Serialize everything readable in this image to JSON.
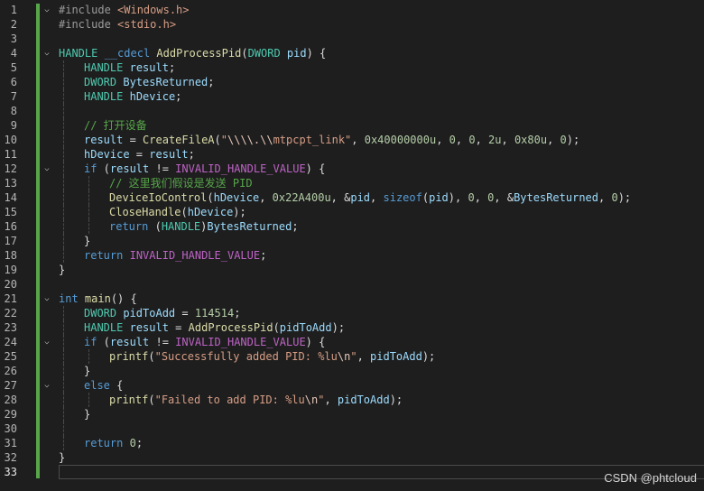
{
  "watermark": "CSDN @phtcloud",
  "current_line": 33,
  "lines": [
    {
      "n": "1",
      "fold": "v",
      "indent": 0,
      "tokens": [
        [
          "t-pp",
          "#include "
        ],
        [
          "t-inc",
          "<Windows.h>"
        ]
      ]
    },
    {
      "n": "2",
      "fold": "",
      "indent": 0,
      "tokens": [
        [
          "t-pp",
          "#include "
        ],
        [
          "t-inc",
          "<stdio.h>"
        ]
      ]
    },
    {
      "n": "3",
      "fold": "",
      "indent": 0,
      "tokens": []
    },
    {
      "n": "4",
      "fold": "v",
      "indent": 0,
      "tokens": [
        [
          "t-type",
          "HANDLE"
        ],
        [
          "t-plain",
          " "
        ],
        [
          "t-kw",
          "__cdecl"
        ],
        [
          "t-plain",
          " "
        ],
        [
          "t-fn",
          "AddProcessPid"
        ],
        [
          "t-plain",
          "("
        ],
        [
          "t-type",
          "DWORD"
        ],
        [
          "t-plain",
          " "
        ],
        [
          "t-var",
          "pid"
        ],
        [
          "t-plain",
          ") {"
        ]
      ]
    },
    {
      "n": "5",
      "fold": "",
      "indent": 1,
      "tokens": [
        [
          "t-type",
          "HANDLE"
        ],
        [
          "t-plain",
          " "
        ],
        [
          "t-var",
          "result"
        ],
        [
          "t-plain",
          ";"
        ]
      ]
    },
    {
      "n": "6",
      "fold": "",
      "indent": 1,
      "tokens": [
        [
          "t-type",
          "DWORD"
        ],
        [
          "t-plain",
          " "
        ],
        [
          "t-var",
          "BytesReturned"
        ],
        [
          "t-plain",
          ";"
        ]
      ]
    },
    {
      "n": "7",
      "fold": "",
      "indent": 1,
      "tokens": [
        [
          "t-type",
          "HANDLE"
        ],
        [
          "t-plain",
          " "
        ],
        [
          "t-var",
          "hDevice"
        ],
        [
          "t-plain",
          ";"
        ]
      ]
    },
    {
      "n": "8",
      "fold": "",
      "indent": 1,
      "tokens": []
    },
    {
      "n": "9",
      "fold": "",
      "indent": 1,
      "tokens": [
        [
          "t-cmt",
          "// 打开设备"
        ]
      ]
    },
    {
      "n": "10",
      "fold": "",
      "indent": 1,
      "tokens": [
        [
          "t-var",
          "result"
        ],
        [
          "t-plain",
          " = "
        ],
        [
          "t-fn",
          "CreateFileA"
        ],
        [
          "t-plain",
          "("
        ],
        [
          "t-str",
          "\""
        ],
        [
          "t-esc",
          "\\\\\\\\.\\\\"
        ],
        [
          "t-str",
          "mtpcpt_link\""
        ],
        [
          "t-plain",
          ", "
        ],
        [
          "t-num",
          "0x40000000u"
        ],
        [
          "t-plain",
          ", "
        ],
        [
          "t-num",
          "0"
        ],
        [
          "t-plain",
          ", "
        ],
        [
          "t-num",
          "0"
        ],
        [
          "t-plain",
          ", "
        ],
        [
          "t-num",
          "2u"
        ],
        [
          "t-plain",
          ", "
        ],
        [
          "t-num",
          "0x80u"
        ],
        [
          "t-plain",
          ", "
        ],
        [
          "t-num",
          "0"
        ],
        [
          "t-plain",
          ");"
        ]
      ]
    },
    {
      "n": "11",
      "fold": "",
      "indent": 1,
      "tokens": [
        [
          "t-var",
          "hDevice"
        ],
        [
          "t-plain",
          " = "
        ],
        [
          "t-var",
          "result"
        ],
        [
          "t-plain",
          ";"
        ]
      ]
    },
    {
      "n": "12",
      "fold": "v",
      "indent": 1,
      "tokens": [
        [
          "t-kw",
          "if"
        ],
        [
          "t-plain",
          " ("
        ],
        [
          "t-var",
          "result"
        ],
        [
          "t-plain",
          " != "
        ],
        [
          "t-macro",
          "INVALID_HANDLE_VALUE"
        ],
        [
          "t-plain",
          ") {"
        ]
      ]
    },
    {
      "n": "13",
      "fold": "",
      "indent": 2,
      "tokens": [
        [
          "t-cmt",
          "// 这里我们假设是发送 PID"
        ]
      ]
    },
    {
      "n": "14",
      "fold": "",
      "indent": 2,
      "tokens": [
        [
          "t-fn",
          "DeviceIoControl"
        ],
        [
          "t-plain",
          "("
        ],
        [
          "t-var",
          "hDevice"
        ],
        [
          "t-plain",
          ", "
        ],
        [
          "t-num",
          "0x22A400u"
        ],
        [
          "t-plain",
          ", &"
        ],
        [
          "t-var",
          "pid"
        ],
        [
          "t-plain",
          ", "
        ],
        [
          "t-kw",
          "sizeof"
        ],
        [
          "t-plain",
          "("
        ],
        [
          "t-var",
          "pid"
        ],
        [
          "t-plain",
          "), "
        ],
        [
          "t-num",
          "0"
        ],
        [
          "t-plain",
          ", "
        ],
        [
          "t-num",
          "0"
        ],
        [
          "t-plain",
          ", &"
        ],
        [
          "t-var",
          "BytesReturned"
        ],
        [
          "t-plain",
          ", "
        ],
        [
          "t-num",
          "0"
        ],
        [
          "t-plain",
          ");"
        ]
      ]
    },
    {
      "n": "15",
      "fold": "",
      "indent": 2,
      "tokens": [
        [
          "t-fn",
          "CloseHandle"
        ],
        [
          "t-plain",
          "("
        ],
        [
          "t-var",
          "hDevice"
        ],
        [
          "t-plain",
          ");"
        ]
      ]
    },
    {
      "n": "16",
      "fold": "",
      "indent": 2,
      "tokens": [
        [
          "t-kw",
          "return"
        ],
        [
          "t-plain",
          " ("
        ],
        [
          "t-type",
          "HANDLE"
        ],
        [
          "t-plain",
          ")"
        ],
        [
          "t-var",
          "BytesReturned"
        ],
        [
          "t-plain",
          ";"
        ]
      ]
    },
    {
      "n": "17",
      "fold": "",
      "indent": 1,
      "tokens": [
        [
          "t-plain",
          "}"
        ]
      ]
    },
    {
      "n": "18",
      "fold": "",
      "indent": 1,
      "tokens": [
        [
          "t-kw",
          "return"
        ],
        [
          "t-plain",
          " "
        ],
        [
          "t-macro",
          "INVALID_HANDLE_VALUE"
        ],
        [
          "t-plain",
          ";"
        ]
      ]
    },
    {
      "n": "19",
      "fold": "",
      "indent": 0,
      "tokens": [
        [
          "t-plain",
          "}"
        ]
      ]
    },
    {
      "n": "20",
      "fold": "",
      "indent": 0,
      "tokens": []
    },
    {
      "n": "21",
      "fold": "v",
      "indent": 0,
      "tokens": [
        [
          "t-kw",
          "int"
        ],
        [
          "t-plain",
          " "
        ],
        [
          "t-fn",
          "main"
        ],
        [
          "t-plain",
          "() {"
        ]
      ]
    },
    {
      "n": "22",
      "fold": "",
      "indent": 1,
      "tokens": [
        [
          "t-type",
          "DWORD"
        ],
        [
          "t-plain",
          " "
        ],
        [
          "t-var",
          "pidToAdd"
        ],
        [
          "t-plain",
          " = "
        ],
        [
          "t-num",
          "114514"
        ],
        [
          "t-plain",
          ";"
        ]
      ]
    },
    {
      "n": "23",
      "fold": "",
      "indent": 1,
      "tokens": [
        [
          "t-type",
          "HANDLE"
        ],
        [
          "t-plain",
          " "
        ],
        [
          "t-var",
          "result"
        ],
        [
          "t-plain",
          " = "
        ],
        [
          "t-fn",
          "AddProcessPid"
        ],
        [
          "t-plain",
          "("
        ],
        [
          "t-var",
          "pidToAdd"
        ],
        [
          "t-plain",
          ");"
        ]
      ]
    },
    {
      "n": "24",
      "fold": "v",
      "indent": 1,
      "tokens": [
        [
          "t-kw",
          "if"
        ],
        [
          "t-plain",
          " ("
        ],
        [
          "t-var",
          "result"
        ],
        [
          "t-plain",
          " != "
        ],
        [
          "t-macro",
          "INVALID_HANDLE_VALUE"
        ],
        [
          "t-plain",
          ") {"
        ]
      ]
    },
    {
      "n": "25",
      "fold": "",
      "indent": 2,
      "tokens": [
        [
          "t-fn",
          "printf"
        ],
        [
          "t-plain",
          "("
        ],
        [
          "t-str",
          "\"Successfully added PID: %lu"
        ],
        [
          "t-esc",
          "\\n"
        ],
        [
          "t-str",
          "\""
        ],
        [
          "t-plain",
          ", "
        ],
        [
          "t-var",
          "pidToAdd"
        ],
        [
          "t-plain",
          ");"
        ]
      ]
    },
    {
      "n": "26",
      "fold": "",
      "indent": 1,
      "tokens": [
        [
          "t-plain",
          "}"
        ]
      ]
    },
    {
      "n": "27",
      "fold": "v",
      "indent": 1,
      "tokens": [
        [
          "t-kw",
          "else"
        ],
        [
          "t-plain",
          " {"
        ]
      ]
    },
    {
      "n": "28",
      "fold": "",
      "indent": 2,
      "tokens": [
        [
          "t-fn",
          "printf"
        ],
        [
          "t-plain",
          "("
        ],
        [
          "t-str",
          "\"Failed to add PID: %lu"
        ],
        [
          "t-esc",
          "\\n"
        ],
        [
          "t-str",
          "\""
        ],
        [
          "t-plain",
          ", "
        ],
        [
          "t-var",
          "pidToAdd"
        ],
        [
          "t-plain",
          ");"
        ]
      ]
    },
    {
      "n": "29",
      "fold": "",
      "indent": 1,
      "tokens": [
        [
          "t-plain",
          "}"
        ]
      ]
    },
    {
      "n": "30",
      "fold": "",
      "indent": 1,
      "tokens": []
    },
    {
      "n": "31",
      "fold": "",
      "indent": 1,
      "tokens": [
        [
          "t-kw",
          "return"
        ],
        [
          "t-plain",
          " "
        ],
        [
          "t-num",
          "0"
        ],
        [
          "t-plain",
          ";"
        ]
      ]
    },
    {
      "n": "32",
      "fold": "",
      "indent": 0,
      "tokens": [
        [
          "t-plain",
          "}"
        ]
      ]
    },
    {
      "n": "33",
      "fold": "",
      "indent": 0,
      "tokens": []
    }
  ]
}
